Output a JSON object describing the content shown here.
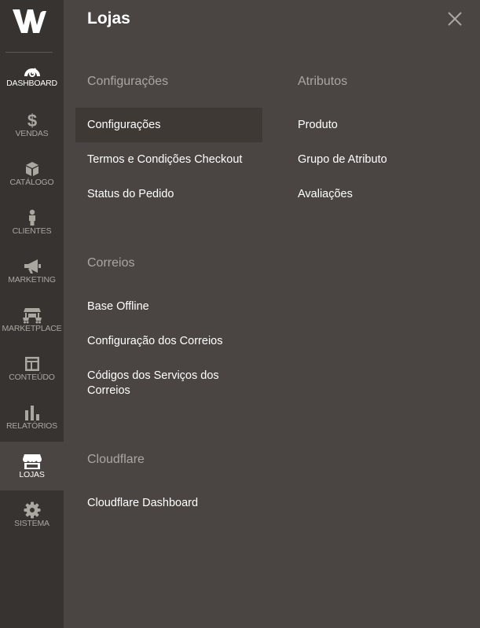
{
  "sidebar": {
    "logo_letter": "W",
    "items": [
      {
        "label": "DASHBOARD",
        "icon": "dashboard-gauge-icon"
      },
      {
        "label": "VENDAS",
        "icon": "dollar-icon"
      },
      {
        "label": "CATÁLOGO",
        "icon": "box-icon"
      },
      {
        "label": "CLIENTES",
        "icon": "person-icon"
      },
      {
        "label": "MARKETING",
        "icon": "megaphone-icon"
      },
      {
        "label": "MARKETPLACE",
        "icon": "marketplace-icon"
      },
      {
        "label": "CONTEÚDO",
        "icon": "layout-icon"
      },
      {
        "label": "RELATÓRIOS",
        "icon": "bar-chart-icon"
      },
      {
        "label": "LOJAS",
        "icon": "store-icon"
      },
      {
        "label": "SISTEMA",
        "icon": "gear-icon"
      }
    ]
  },
  "panel": {
    "title": "Lojas",
    "sections": [
      {
        "title": "Configurações",
        "links": [
          "Configurações",
          "Termos e Condições Checkout",
          "Status do Pedido"
        ]
      },
      {
        "title": "Atributos",
        "links": [
          "Produto",
          "Grupo de Atributo",
          "Avaliações"
        ]
      },
      {
        "title": "Correios",
        "links": [
          "Base Offline",
          "Configuração dos Correios",
          "Códigos dos Serviços dos Correios"
        ]
      },
      {
        "title": "Cloudflare",
        "links": [
          "Cloudflare Dashboard"
        ]
      }
    ]
  },
  "colors": {
    "sidebar_bg": "#373330",
    "panel_bg": "#4a4542",
    "highlight_bg": "#3e3935",
    "section_title": "#aaa6a0",
    "link": "#ffffff"
  }
}
